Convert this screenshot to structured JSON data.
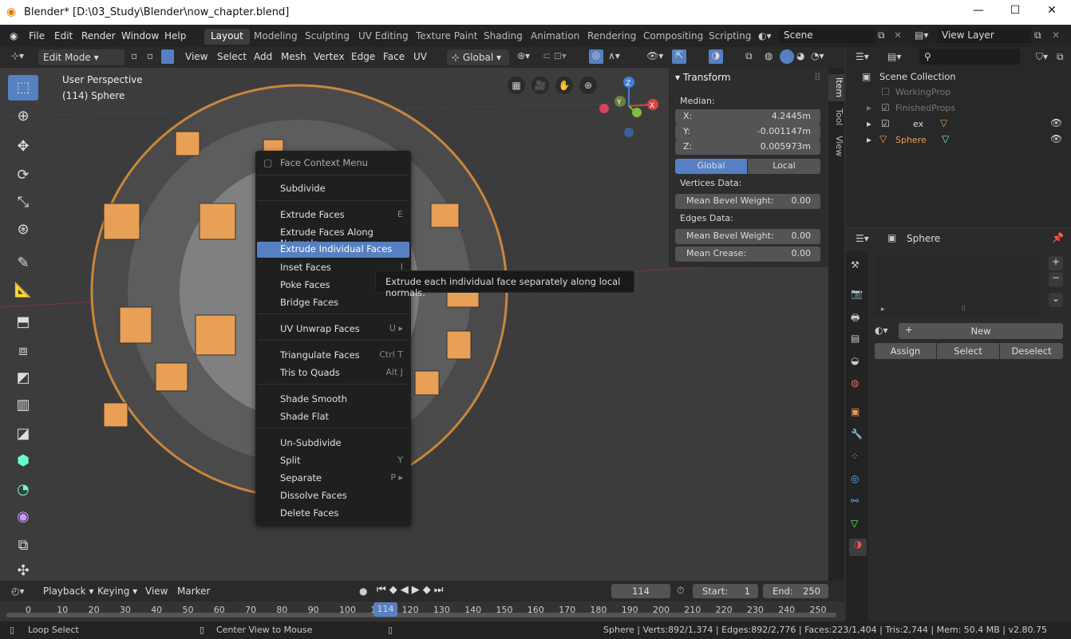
{
  "window": {
    "title": "Blender* [D:\\03_Study\\Blender\\now_chapter.blend]",
    "minimize": "—",
    "maximize": "☐",
    "close": "✕"
  },
  "menubar": {
    "items": [
      "File",
      "Edit",
      "Render",
      "Window",
      "Help"
    ]
  },
  "workspaces": [
    "Layout",
    "Modeling",
    "Sculpting",
    "UV Editing",
    "Texture Paint",
    "Shading",
    "Animation",
    "Rendering",
    "Compositing",
    "Scripting"
  ],
  "scene": "Scene",
  "view_layer": "View Layer",
  "header3d": {
    "mode": "Edit Mode",
    "menus": [
      "View",
      "Select",
      "Add",
      "Mesh",
      "Vertex",
      "Edge",
      "Face",
      "UV"
    ],
    "orientation": "Global"
  },
  "viewport": {
    "perspective": "User Perspective",
    "object_info": "(114) Sphere",
    "axes": {
      "x": "X",
      "y": "Y",
      "z": "Z"
    }
  },
  "transform": {
    "title": "Transform",
    "median": "Median:",
    "x_label": "X:",
    "x": "4.2445m",
    "y_label": "Y:",
    "y": "-0.001147m",
    "z_label": "Z:",
    "z": "0.005973m",
    "global": "Global",
    "local": "Local",
    "vertices_data": "Vertices Data:",
    "mean_bevel_weight": "Mean Bevel Weight:",
    "vbw": "0.00",
    "edges_data": "Edges Data:",
    "ebw": "0.00",
    "mean_crease": "Mean Crease:",
    "crease": "0.00"
  },
  "ntabs": [
    "Item",
    "Tool",
    "View"
  ],
  "context_menu": {
    "title": "Face Context Menu",
    "items": [
      {
        "label": "Subdivide",
        "shortcut": ""
      },
      {
        "label": "Extrude Faces",
        "shortcut": "E"
      },
      {
        "label": "Extrude Faces Along Normals",
        "shortcut": ""
      },
      {
        "label": "Extrude Individual Faces",
        "shortcut": ""
      },
      {
        "label": "Inset Faces",
        "shortcut": "I"
      },
      {
        "label": "Poke Faces",
        "shortcut": ""
      },
      {
        "label": "Bridge Faces",
        "shortcut": ""
      },
      {
        "label": "UV Unwrap Faces",
        "shortcut": "U ▸"
      },
      {
        "label": "Triangulate Faces",
        "shortcut": "Ctrl T"
      },
      {
        "label": "Tris to Quads",
        "shortcut": "Alt J"
      },
      {
        "label": "Shade Smooth",
        "shortcut": ""
      },
      {
        "label": "Shade Flat",
        "shortcut": ""
      },
      {
        "label": "Un-Subdivide",
        "shortcut": ""
      },
      {
        "label": "Split",
        "shortcut": "Y"
      },
      {
        "label": "Separate",
        "shortcut": "P ▸"
      },
      {
        "label": "Dissolve Faces",
        "shortcut": ""
      },
      {
        "label": "Delete Faces",
        "shortcut": ""
      }
    ]
  },
  "tooltip": "Extrude each individual face separately along local normals.",
  "outliner": {
    "collection": "Scene Collection",
    "items": [
      "WorkingProp",
      "FinishedProps",
      "ex",
      "Sphere"
    ]
  },
  "properties": {
    "object": "Sphere",
    "new": "New",
    "assign": "Assign",
    "select": "Select",
    "deselect": "Deselect"
  },
  "timeline": {
    "playback": "Playback",
    "keying": "Keying",
    "view": "View",
    "marker": "Marker",
    "current": "114",
    "start_label": "Start:",
    "start": "1",
    "end_label": "End:",
    "end": "250",
    "ticks": [
      "0",
      "10",
      "20",
      "30",
      "40",
      "50",
      "60",
      "70",
      "80",
      "90",
      "100",
      "110",
      "120",
      "130",
      "140",
      "150",
      "160",
      "170",
      "180",
      "190",
      "200",
      "210",
      "220",
      "230",
      "240",
      "250"
    ]
  },
  "status": {
    "left1": "Loop Select",
    "left2": "Center View to Mouse",
    "right": "Sphere | Verts:892/1,374 | Edges:892/2,776 | Faces:223/1,404 | Tris:2,744 | Mem: 50.4 MB | v2.80.75"
  },
  "colors": {
    "accent": "#5680c2",
    "orange": "#e8a056",
    "bg": "#3c3c3c"
  }
}
